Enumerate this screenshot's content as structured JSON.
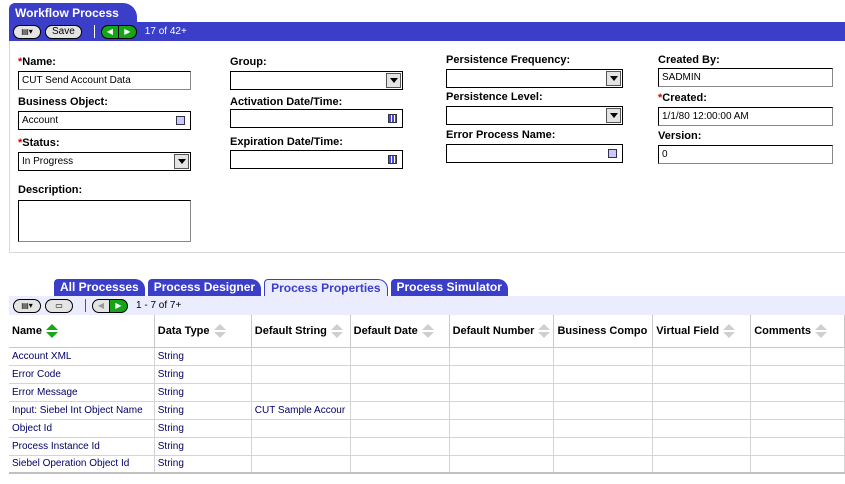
{
  "workflow": {
    "title": "Workflow Process",
    "toolbar": {
      "save_label": "Save",
      "record_count": "17 of 42+"
    },
    "fields": {
      "name": {
        "label": "Name:",
        "value": "CUT Send Account Data"
      },
      "business_object": {
        "label": "Business Object:",
        "value": "Account"
      },
      "status": {
        "label": "Status:",
        "value": "In Progress"
      },
      "description": {
        "label": "Description:",
        "value": ""
      },
      "group": {
        "label": "Group:",
        "value": ""
      },
      "activation": {
        "label": "Activation Date/Time:",
        "value": ""
      },
      "expiration": {
        "label": "Expiration Date/Time:",
        "value": ""
      },
      "persistence_frequency": {
        "label": "Persistence Frequency:",
        "value": ""
      },
      "persistence_level": {
        "label": "Persistence Level:",
        "value": ""
      },
      "error_process": {
        "label": "Error Process Name:",
        "value": ""
      },
      "created_by": {
        "label": "Created By:",
        "value": "SADMIN"
      },
      "created": {
        "label": "Created:",
        "value": "1/1/80 12:00:00 AM"
      },
      "version": {
        "label": "Version:",
        "value": "0"
      }
    }
  },
  "tabs": [
    "All Processes",
    "Process Designer",
    "Process Properties",
    "Process Simulator"
  ],
  "active_tab": "Process Properties",
  "list": {
    "record_count": "1 - 7 of 7+",
    "columns": [
      "Name",
      "Data Type",
      "Default String",
      "Default Date",
      "Default Number",
      "Business Compo",
      "Virtual Field",
      "Comments"
    ],
    "rows": [
      [
        "Account XML",
        "String",
        "",
        "",
        "",
        "",
        "",
        ""
      ],
      [
        "Error Code",
        "String",
        "",
        "",
        "",
        "",
        "",
        ""
      ],
      [
        "Error Message",
        "String",
        "",
        "",
        "",
        "",
        "",
        ""
      ],
      [
        "Input: Siebel Int Object Name",
        "String",
        "CUT Sample Accour",
        "",
        "",
        "",
        "",
        ""
      ],
      [
        "Object Id",
        "String",
        "",
        "",
        "",
        "",
        "",
        ""
      ],
      [
        "Process Instance Id",
        "String",
        "",
        "",
        "",
        "",
        "",
        ""
      ],
      [
        "Siebel Operation Object Id",
        "String",
        "",
        "",
        "",
        "",
        "",
        ""
      ]
    ]
  },
  "colors": {
    "applet_blue": "#3b3ec9",
    "nav_green": "#16a516",
    "required_red": "#d40000",
    "list_text": "#000066"
  }
}
